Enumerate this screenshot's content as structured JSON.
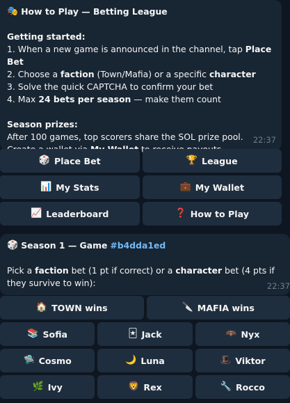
{
  "help_message": {
    "title_icon": "theater-masks-emoji",
    "title": "How to Play — Betting League",
    "getting_started_heading": "Getting started:",
    "steps": [
      {
        "pre": "1. When a new game is announced in the channel, tap ",
        "bold": "Place Bet",
        "post": ""
      },
      {
        "pre": "2. Choose a ",
        "bold": "faction",
        "mid": " (Town/Mafia) or a specific ",
        "bold2": "character",
        "post": ""
      },
      {
        "pre": "3. Solve the quick CAPTCHA to confirm your bet",
        "bold": "",
        "post": ""
      },
      {
        "pre": "4. Max ",
        "bold": "24 bets per season",
        "post": " — make them count"
      }
    ],
    "prizes_heading": "Season prizes:",
    "prizes_line1": "After 100 games, top scorers share the SOL prize pool.",
    "prizes_line2_pre": "Create a wallet via ",
    "prizes_line2_bold": "My Wallet",
    "prizes_line2_post": " to receive payouts.",
    "time": "22:37"
  },
  "menu_keyboard": [
    {
      "icon": "🎲",
      "icon_name": "dice-icon",
      "label": "Place Bet"
    },
    {
      "icon": "🏆",
      "icon_name": "trophy-icon",
      "label": "League"
    },
    {
      "icon": "📊",
      "icon_name": "bar-chart-icon",
      "label": "My Stats"
    },
    {
      "icon": "💼",
      "icon_name": "briefcase-icon",
      "label": "My Wallet"
    },
    {
      "icon": "📈",
      "icon_name": "chart-increasing-icon",
      "label": "Leaderboard"
    },
    {
      "icon": "❓",
      "icon_name": "question-mark-icon",
      "label": "How to Play"
    }
  ],
  "game_message": {
    "title_icon": "dice-icon",
    "title": "Season 1 — Game ",
    "game_tag": "#b4dda1ed",
    "body_pre": "Pick a ",
    "body_bold1": "faction",
    "body_mid": " bet (1 pt if correct) or a ",
    "body_bold2": "character",
    "body_post": " bet (4 pts if they survive to win):",
    "time": "22:37"
  },
  "bet_keyboard": {
    "factions": [
      {
        "icon": "🏠",
        "icon_name": "house-icon",
        "label": "TOWN wins"
      },
      {
        "icon": "🔪",
        "icon_name": "knife-icon",
        "label": "MAFIA wins"
      }
    ],
    "characters": [
      {
        "icon": "📚",
        "icon_name": "books-icon",
        "label": "Sofia"
      },
      {
        "icon": "🃏",
        "icon_name": "playing-card-icon",
        "label": "Jack"
      },
      {
        "icon": "🦇",
        "icon_name": "bat-icon",
        "label": "Nyx"
      },
      {
        "icon": "🛸",
        "icon_name": "flying-saucer-icon",
        "label": "Cosmo"
      },
      {
        "icon": "🌙",
        "icon_name": "crescent-moon-icon",
        "label": "Luna"
      },
      {
        "icon": "🎩",
        "icon_name": "top-hat-icon",
        "label": "Viktor"
      },
      {
        "icon": "🌿",
        "icon_name": "herb-icon",
        "label": "Ivy"
      },
      {
        "icon": "🦁",
        "icon_name": "lion-icon",
        "label": "Rex"
      },
      {
        "icon": "🔧",
        "icon_name": "wrench-icon",
        "label": "Rocco"
      }
    ]
  }
}
